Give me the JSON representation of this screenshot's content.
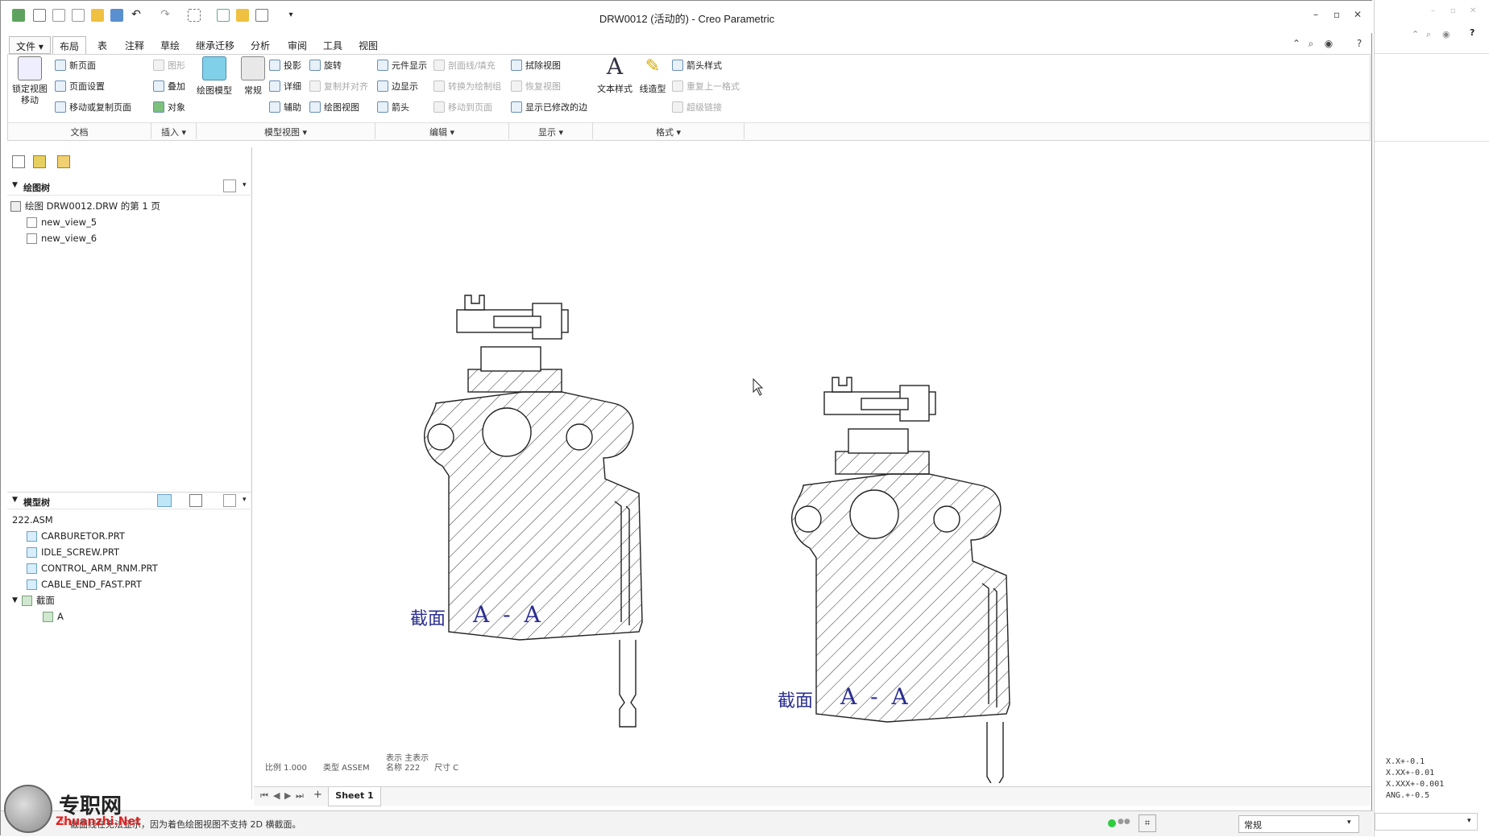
{
  "window": {
    "title": "DRW0012 (活动的) - Creo Parametric"
  },
  "menu": {
    "file": "文件",
    "tabs": [
      "布局",
      "表",
      "注释",
      "草绘",
      "继承迁移",
      "分析",
      "审阅",
      "工具",
      "视图"
    ],
    "active_tab": "布局"
  },
  "ribbon": {
    "lock_view_move": "锁定视图\n移动",
    "new_page": "新页面",
    "page_setup": "页面设置",
    "move_copy_page": "移动或复制页面",
    "shape": "图形",
    "overlay": "叠加",
    "object": "对象",
    "drawing_model": "绘图模型",
    "general": "常规",
    "projection": "投影",
    "rotate": "旋转",
    "detail": "详细",
    "copy_align": "复制并对齐",
    "auxiliary": "辅助",
    "drawing_view": "绘图视图",
    "component_display": "元件显示",
    "section_line_fill": "剖面线/填充",
    "convert_to_draft": "转换为绘制组",
    "move_to_page": "移动到页面",
    "edge_display": "边显示",
    "arrow": "箭头",
    "erase_view": "拭除视图",
    "restore_view": "恢复视图",
    "show_modified_edges": "显示已修改的边",
    "text_style": "文本样式",
    "line_style": "线造型",
    "arrow_style": "箭头样式",
    "repeat_last_format": "重复上一格式",
    "hyperlink": "超级链接",
    "groups": [
      "文档",
      "插入 ▾",
      "模型视图 ▾",
      "编辑 ▾",
      "显示 ▾",
      "格式 ▾"
    ]
  },
  "drawing_tree": {
    "header": "绘图树",
    "root": "绘图 DRW0012.DRW 的第 1 页",
    "items": [
      "new_view_5",
      "new_view_6"
    ]
  },
  "model_tree": {
    "header": "模型树",
    "root": "222.ASM",
    "items": [
      "CARBURETOR.PRT",
      "IDLE_SCREW.PRT",
      "CONTROL_ARM_RNM.PRT",
      "CABLE_END_FAST.PRT"
    ],
    "section_folder": "截面",
    "section_item": "A"
  },
  "drawing": {
    "section_label_cn": "截面",
    "section_label_id": "A - A"
  },
  "draw_info": {
    "scale": "比例 1.000",
    "type": "类型 ASSEM",
    "rep": "表示 主表示",
    "name": "名称 222",
    "size": "尺寸 C"
  },
  "sheet": {
    "tab": "Sheet 1"
  },
  "status": {
    "message": "截面线在无法显示，因为着色绘图视图不支持 2D 横截面。",
    "filter": "常规"
  },
  "tolerance": {
    "lines": [
      "X.X+-0.1",
      "X.XX+-0.01",
      "X.XXX+-0.001",
      "ANG.+-0.5"
    ]
  },
  "watermark": {
    "cn": "专职网",
    "en": "Zhuanzhi.Net"
  },
  "colors": {
    "section_text": "#2b2f8f",
    "tree_icon": "#6aa0c8",
    "status_green": "#2ecc40"
  }
}
